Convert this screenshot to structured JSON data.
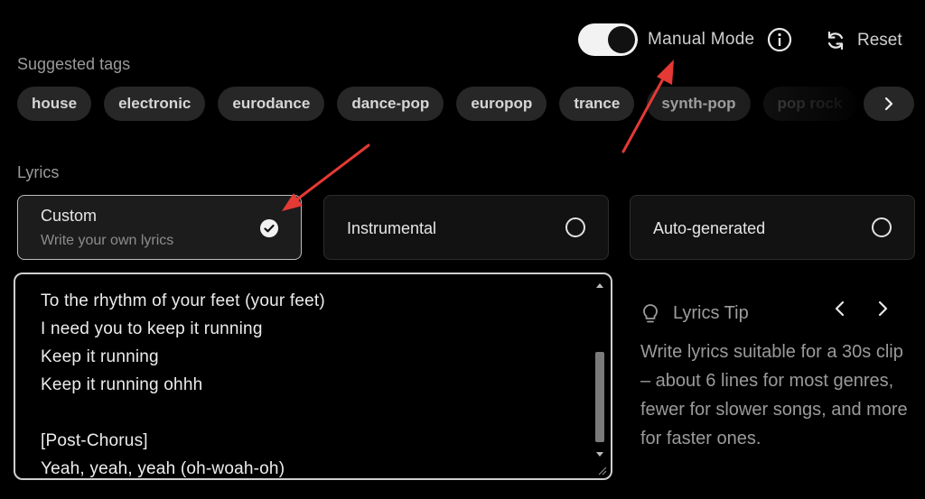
{
  "header": {
    "manual_mode_label": "Manual Mode",
    "manual_mode_on": true,
    "reset_label": "Reset"
  },
  "tags": {
    "label": "Suggested tags",
    "items": [
      "house",
      "electronic",
      "eurodance",
      "dance-pop",
      "europop",
      "trance",
      "synth-pop",
      "pop rock"
    ]
  },
  "lyrics": {
    "label": "Lyrics",
    "options": [
      {
        "title": "Custom",
        "subtitle": "Write your own lyrics",
        "selected": true
      },
      {
        "title": "Instrumental",
        "selected": false
      },
      {
        "title": "Auto-generated",
        "selected": false
      }
    ],
    "text_lines": [
      "To the rhythm of your feet (your feet)",
      "I need you to keep it running",
      "Keep it running",
      "Keep it running ohhh",
      "",
      "[Post-Chorus]",
      "Yeah, yeah, yeah (oh-woah-oh)"
    ]
  },
  "tip": {
    "title": "Lyrics Tip",
    "body": "Write lyrics suitable for a 30s clip – about 6 lines for most genres, fewer for slower songs, and more for faster ones."
  },
  "colors": {
    "background": "#000000",
    "tag_bg": "#272727",
    "annotation_arrow": "#e53935"
  }
}
